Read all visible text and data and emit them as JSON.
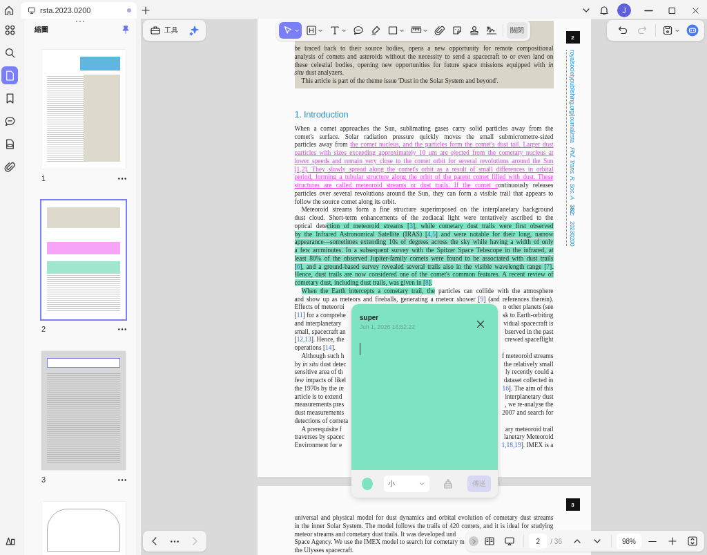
{
  "tab": {
    "title": "rsta.2023.0200",
    "modified": true
  },
  "account": {
    "initial": "J"
  },
  "rail": [
    {
      "kind": "grid",
      "selected": false
    },
    {
      "kind": "search",
      "selected": false
    },
    {
      "kind": "page",
      "selected": true
    },
    {
      "kind": "bookmark",
      "selected": false
    },
    {
      "kind": "comment",
      "selected": false
    },
    {
      "kind": "form",
      "selected": false
    },
    {
      "kind": "paperclip",
      "selected": false
    }
  ],
  "sidebar": {
    "title": "縮圖",
    "pinned": true,
    "thumbnails": [
      {
        "kind": "cover",
        "label": "1",
        "selected": false
      },
      {
        "kind": "highlighted",
        "label": "2",
        "selected": true
      },
      {
        "kind": "shaded",
        "label": "3",
        "selected": false
      },
      {
        "kind": "figure",
        "selected": false
      }
    ]
  },
  "tools_button": "工具",
  "annotation_tools": [
    {
      "kind": "cursor",
      "selected": true,
      "menu": true
    },
    {
      "kind": "textbox",
      "selected": false,
      "menu": true
    },
    {
      "kind": "text",
      "selected": false,
      "menu": true
    },
    {
      "kind": "comment",
      "selected": false,
      "menu": false
    },
    {
      "kind": "highlighter",
      "selected": false,
      "menu": false
    },
    {
      "kind": "rectangle",
      "selected": false,
      "menu": true
    },
    {
      "kind": "ruler",
      "selected": false,
      "menu": true
    },
    {
      "kind": "paperclip",
      "selected": false,
      "menu": false
    },
    {
      "kind": "sticker",
      "selected": false,
      "menu": false
    },
    {
      "kind": "stamp",
      "selected": false,
      "menu": false
    },
    {
      "kind": "signature",
      "selected": false,
      "menu": false
    }
  ],
  "close_label": "關閉",
  "history": {
    "undo_enabled": true,
    "redo_enabled": false
  },
  "page": {
    "number": "2",
    "abstract_lines": [
      {
        "kind": "full",
        "indent": false,
        "segments": [
          {
            "kind": "plain",
            "text": "be traced back to their source bodies, opens a new opportunity for remote compositional"
          }
        ]
      },
      {
        "kind": "full",
        "indent": false,
        "segments": [
          {
            "kind": "plain",
            "text": "analysis of comets and asteroids without the necessity to send a spacecraft to or even land on"
          }
        ]
      },
      {
        "kind": "full",
        "indent": false,
        "segments": [
          {
            "kind": "plain",
            "text": "these celestial bodies, opening new opportunities for future space missions equipped with *in*"
          }
        ]
      },
      {
        "kind": "last",
        "indent": false,
        "segments": [
          {
            "kind": "plain",
            "text": "*situ* dust analyzers."
          }
        ]
      },
      {
        "kind": "last",
        "indent": true,
        "segments": [
          {
            "kind": "plain",
            "text": "This article is part of the theme issue 'Dust in the Solar System and beyond'."
          }
        ]
      }
    ],
    "heading": "1. Introduction",
    "lines": [
      {
        "kind": "full",
        "indent": false,
        "segments": [
          {
            "kind": "plain",
            "text": "When a comet approaches the Sun, sublimating gases carry solid particles away from the"
          }
        ]
      },
      {
        "kind": "full",
        "indent": false,
        "segments": [
          {
            "kind": "plain",
            "text": "comet's surface. Solar radiation pressure quickly moves the small submicrometre-sized"
          }
        ]
      },
      {
        "kind": "full",
        "indent": false,
        "segments": [
          {
            "kind": "plain",
            "text": "particles away from "
          },
          {
            "kind": "pink",
            "text": "the comet nucleus, and the particles form the comet's dust tail. Larger dust"
          }
        ]
      },
      {
        "kind": "full",
        "indent": false,
        "segments": [
          {
            "kind": "pink",
            "text": "particles with sizes exceeding approximately 10 μm are ejected from the cometary nucleus at"
          }
        ]
      },
      {
        "kind": "full",
        "indent": false,
        "segments": [
          {
            "kind": "pink",
            "text": "lower speeds and remain very close to the comet orbit for several revolutions around the Sun"
          }
        ]
      },
      {
        "kind": "full",
        "indent": false,
        "segments": [
          {
            "kind": "pink",
            "text": "[1,2]. They slowly spread along the comet's orbit as a result of small differences in orbital"
          }
        ]
      },
      {
        "kind": "full",
        "indent": false,
        "segments": [
          {
            "kind": "pink",
            "text": "period, forming a tubular structure along the orbit of the parent comet filled with dust. These"
          }
        ]
      },
      {
        "kind": "full",
        "indent": false,
        "segments": [
          {
            "kind": "pink",
            "text": "structures are called meteoroid streams or dust trails. If the comet c"
          },
          {
            "kind": "plain",
            "text": "ontinuously releases"
          }
        ]
      },
      {
        "kind": "full",
        "indent": false,
        "segments": [
          {
            "kind": "plain",
            "text": "particles over several revolutions around the Sun, they can form a visible trail that appears to"
          }
        ]
      },
      {
        "kind": "last",
        "indent": false,
        "segments": [
          {
            "kind": "plain",
            "text": "follow the source comet along its orbit."
          }
        ]
      },
      {
        "kind": "full",
        "indent": true,
        "segments": [
          {
            "kind": "plain",
            "text": "Meteoroid streams form a fine structure superimposed on the interplanetary background"
          }
        ]
      },
      {
        "kind": "full",
        "indent": false,
        "segments": [
          {
            "kind": "plain",
            "text": "dust cloud. Short-term enhancements of the zodiacal light were tentatively ascribed to the"
          }
        ]
      },
      {
        "kind": "full",
        "indent": false,
        "segments": [
          {
            "kind": "plain",
            "text": "optical dete"
          },
          {
            "kind": "green",
            "text": "ction of meteoroid streams ["
          },
          {
            "kind": "green-ref",
            "text": "3"
          },
          {
            "kind": "green",
            "text": "], while cometary dust trails were first observed"
          }
        ]
      },
      {
        "kind": "full",
        "indent": false,
        "segments": [
          {
            "kind": "green",
            "text": "by the Infrared Astronomical Satellite (IRAS) ["
          },
          {
            "kind": "green-ref",
            "text": "4,5"
          },
          {
            "kind": "green",
            "text": "] and were notable for their long, narrow"
          }
        ]
      },
      {
        "kind": "full",
        "indent": false,
        "segments": [
          {
            "kind": "green",
            "text": "appearance—sometimes extending 10s of degrees across the sky while having a width of only"
          }
        ]
      },
      {
        "kind": "full",
        "indent": false,
        "segments": [
          {
            "kind": "green",
            "text": "a few arcminutes. In a subsequent survey with the Spitzer Space Telescope in the infrared, at"
          }
        ]
      },
      {
        "kind": "full",
        "indent": false,
        "segments": [
          {
            "kind": "green",
            "text": "least 80% of the observed Jupiter-family comets were found to be associated with dust trails"
          }
        ]
      },
      {
        "kind": "full",
        "indent": false,
        "segments": [
          {
            "kind": "green",
            "text": "["
          },
          {
            "kind": "green-ref",
            "text": "6"
          },
          {
            "kind": "green",
            "text": "], and a ground-based survey revealed several trails also in the visible wavelength range ["
          },
          {
            "kind": "green-ref",
            "text": "7"
          },
          {
            "kind": "green",
            "text": "]."
          }
        ]
      },
      {
        "kind": "full",
        "indent": false,
        "segments": [
          {
            "kind": "green",
            "text": "Hence, dust trails are now considered one of the comet's common features. A recent review of"
          }
        ]
      },
      {
        "kind": "last",
        "indent": false,
        "segments": [
          {
            "kind": "green",
            "text": "cometary dust, including dust trails, was given in ["
          },
          {
            "kind": "green-ref",
            "text": "8"
          },
          {
            "kind": "green",
            "text": "]."
          }
        ]
      },
      {
        "kind": "full",
        "indent": true,
        "segments": [
          {
            "kind": "green",
            "text": "When the Earth intercepts a cometary trail, the"
          },
          {
            "kind": "plain",
            "text": " particles can collide with the atmosphere"
          }
        ]
      },
      {
        "kind": "full",
        "indent": false,
        "segments": [
          {
            "kind": "plain",
            "text": "and show up as meteors and fireballs, generating a meteor shower ["
          },
          {
            "kind": "ref",
            "text": "9"
          },
          {
            "kind": "plain",
            "text": "] (and references therein)."
          }
        ]
      },
      {
        "kind": "split",
        "indent": false,
        "left": [
          {
            "kind": "plain",
            "text": "Effects of meteoroi"
          }
        ],
        "right": [
          {
            "kind": "plain",
            "text": "n other planets (see"
          }
        ]
      },
      {
        "kind": "split",
        "indent": false,
        "left": [
          {
            "kind": "plain",
            "text": "["
          },
          {
            "kind": "ref",
            "text": "11"
          },
          {
            "kind": "plain",
            "text": "] for a comprehe"
          }
        ],
        "right": [
          {
            "kind": "plain",
            "text": "sk to Earth-orbiting"
          }
        ]
      },
      {
        "kind": "split",
        "indent": false,
        "left": [
          {
            "kind": "plain",
            "text": "and interplanetary"
          }
        ],
        "right": [
          {
            "kind": "plain",
            "text": "vidual spacecraft is"
          }
        ]
      },
      {
        "kind": "split",
        "indent": false,
        "left": [
          {
            "kind": "plain",
            "text": "small, spacecraft an"
          }
        ],
        "right": [
          {
            "kind": "plain",
            "text": "bserved in the past"
          }
        ]
      },
      {
        "kind": "split",
        "indent": false,
        "left": [
          {
            "kind": "plain",
            "text": "["
          },
          {
            "kind": "ref",
            "text": "12,13"
          },
          {
            "kind": "plain",
            "text": "]. Hence, the"
          }
        ],
        "right": [
          {
            "kind": "plain",
            "text": "crewed spaceflight"
          }
        ]
      },
      {
        "kind": "last",
        "indent": false,
        "segments": [
          {
            "kind": "plain",
            "text": "operations ["
          },
          {
            "kind": "ref",
            "text": "14"
          },
          {
            "kind": "plain",
            "text": "]."
          }
        ]
      },
      {
        "kind": "split",
        "indent": true,
        "left": [
          {
            "kind": "plain",
            "text": "Although such h"
          }
        ],
        "right": [
          {
            "kind": "plain",
            "text": "f meteoroid streams"
          }
        ]
      },
      {
        "kind": "split",
        "indent": false,
        "left": [
          {
            "kind": "plain",
            "text": "by *in situ* dust detec"
          }
        ],
        "right": [
          {
            "kind": "plain",
            "text": "the relatively small"
          }
        ]
      },
      {
        "kind": "split",
        "indent": false,
        "left": [
          {
            "kind": "plain",
            "text": "sensitive area of th"
          }
        ],
        "right": [
          {
            "kind": "plain",
            "text": "ly recently could a"
          }
        ]
      },
      {
        "kind": "split",
        "indent": false,
        "left": [
          {
            "kind": "plain",
            "text": "few impacts of likel"
          }
        ],
        "right": [
          {
            "kind": "plain",
            "text": "dataset collected in"
          }
        ]
      },
      {
        "kind": "split",
        "indent": false,
        "left": [
          {
            "kind": "plain",
            "text": "the 1970s by the *in*"
          }
        ],
        "right": [
          {
            "kind": "ref",
            "text": "16"
          },
          {
            "kind": "plain",
            "text": "]. The aim of this"
          }
        ]
      },
      {
        "kind": "split",
        "indent": false,
        "left": [
          {
            "kind": "plain",
            "text": "article is to extend"
          }
        ],
        "right": [
          {
            "kind": "plain",
            "text": "interplanetary dust"
          }
        ]
      },
      {
        "kind": "split",
        "indent": false,
        "left": [
          {
            "kind": "plain",
            "text": "measurements pres"
          }
        ],
        "right": [
          {
            "kind": "plain",
            "text": ", we re-analyse the"
          }
        ]
      },
      {
        "kind": "split",
        "indent": false,
        "left": [
          {
            "kind": "plain",
            "text": "dust measurements"
          }
        ],
        "right": [
          {
            "kind": "plain",
            "text": "2007 and search for"
          }
        ]
      },
      {
        "kind": "last",
        "indent": false,
        "segments": [
          {
            "kind": "plain",
            "text": "detections of cometa"
          }
        ]
      },
      {
        "kind": "split",
        "indent": true,
        "left": [
          {
            "kind": "plain",
            "text": "A prerequisite f"
          }
        ],
        "right": [
          {
            "kind": "plain",
            "text": "ary meteoroid trail"
          }
        ]
      },
      {
        "kind": "split",
        "indent": false,
        "left": [
          {
            "kind": "plain",
            "text": "traverses by spacec"
          }
        ],
        "right": [
          {
            "kind": "plain",
            "text": "lanetary Meteoroid"
          }
        ]
      },
      {
        "kind": "split",
        "indent": false,
        "left": [
          {
            "kind": "plain",
            "text": "Environment for e"
          }
        ],
        "right": [
          {
            "kind": "ref",
            "text": "1,18,19"
          },
          {
            "kind": "plain",
            "text": "]. IMEX is a"
          }
        ]
      }
    ],
    "margin": {
      "url": "royalsocietypublishing.org/journal/rsta",
      "journal": "Phil. Trans. R. Soc. A",
      "volume": "382:",
      "article": "20230200"
    }
  },
  "note": {
    "author": "super",
    "time": "Jun 1, 2026 16:52:22",
    "font_size": "小",
    "send": "傳送",
    "send_enabled": false
  },
  "next_page": {
    "number": "3",
    "lines": [
      {
        "kind": "full",
        "indent": false,
        "segments": [
          {
            "kind": "plain",
            "text": "universal and physical model for dust dynamics and orbital evolution of cometary dust streams"
          }
        ]
      },
      {
        "kind": "full",
        "indent": false,
        "segments": [
          {
            "kind": "plain",
            "text": "in the inner Solar System. The model follows the trails of 420 comets, and it is ideal for studying"
          }
        ]
      },
      {
        "kind": "last",
        "indent": false,
        "segments": [
          {
            "kind": "plain",
            "text": "meteor streams and cometary dust trails. It was developed und"
          }
        ]
      },
      {
        "kind": "last",
        "indent": false,
        "segments": [
          {
            "kind": "plain",
            "text": "Space Agency. We use the IMEX model to search for cometary m"
          }
        ]
      },
      {
        "kind": "last",
        "indent": false,
        "segments": [
          {
            "kind": "plain",
            "text": "the Ulysses spacecraft."
          }
        ]
      }
    ]
  },
  "navigation": {
    "prev_enabled": true,
    "next_enabled": false,
    "page": "2",
    "total": "/ 36",
    "zoom": "98%"
  }
}
